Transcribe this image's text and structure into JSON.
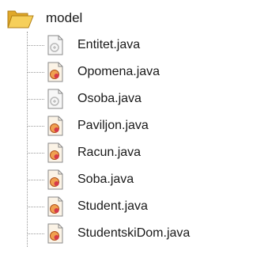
{
  "tree": {
    "folder": {
      "label": "model",
      "icon": "folder-open-icon",
      "color": "#f4c542"
    },
    "files": [
      {
        "label": "Entitet.java",
        "icon": "java-file-icon",
        "variant": "plain"
      },
      {
        "label": "Opomena.java",
        "icon": "java-class-icon",
        "variant": "class"
      },
      {
        "label": "Osoba.java",
        "icon": "java-file-icon",
        "variant": "plain"
      },
      {
        "label": "Paviljon.java",
        "icon": "java-class-icon",
        "variant": "class"
      },
      {
        "label": "Racun.java",
        "icon": "java-class-icon",
        "variant": "class"
      },
      {
        "label": "Soba.java",
        "icon": "java-class-icon",
        "variant": "class"
      },
      {
        "label": "Student.java",
        "icon": "java-class-icon",
        "variant": "class"
      },
      {
        "label": "StudentskiDom.java",
        "icon": "java-class-icon",
        "variant": "class"
      }
    ]
  }
}
